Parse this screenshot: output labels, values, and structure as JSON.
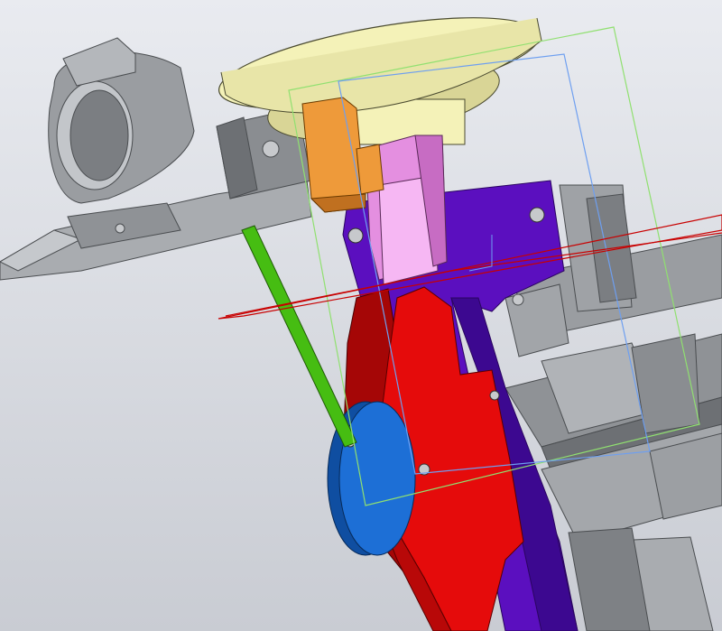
{
  "viewport": {
    "background_top": "#e9ebf0",
    "background_bottom": "#c9ccd3"
  },
  "colors": {
    "gray_part": "#8f9296",
    "gray_part_light": "#c5c8cc",
    "gray_part_dark": "#55585c",
    "yellow_disc": "#f4f2b8",
    "yellow_disc_shade": "#d9d596",
    "orange_bracket": "#ee9a3a",
    "pink_block": "#e48fe0",
    "pink_block_light": "#f6b7f3",
    "purple_plate": "#5b0fbf",
    "purple_plate_dark": "#3c0890",
    "red_plate": "#e50b0b",
    "red_plate_dark": "#a50606",
    "green_link": "#46bd12",
    "blue_pulley": "#1d6fd6",
    "blue_pulley_dark": "#0f4ea1",
    "plane_red": "#c80000",
    "plane_green": "#90e070",
    "plane_blue": "#6e9ff0",
    "pin": "#c7c9cc"
  },
  "icons": {
    "model": "cad-assembly-icon"
  }
}
